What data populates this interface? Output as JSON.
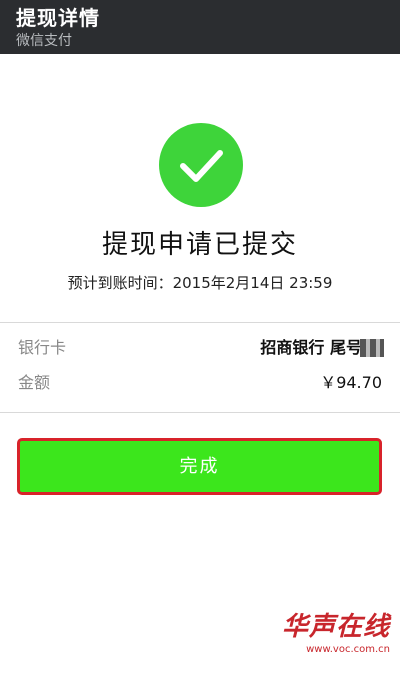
{
  "header": {
    "title": "提现详情",
    "subtitle": "微信支付"
  },
  "status": {
    "icon": "check-icon",
    "icon_color": "#3ed43a",
    "title": "提现申请已提交",
    "eta": "预计到账时间：2015年2月14日 23:59"
  },
  "details": [
    {
      "label": "银行卡",
      "value": "招商银行 尾号"
    },
    {
      "label": "金额",
      "value": "￥94.70"
    }
  ],
  "done_button": {
    "label": "完成",
    "color": "#3ce61c"
  },
  "watermark": {
    "brand": "华声在线",
    "url": "www.voc.com.cn"
  }
}
